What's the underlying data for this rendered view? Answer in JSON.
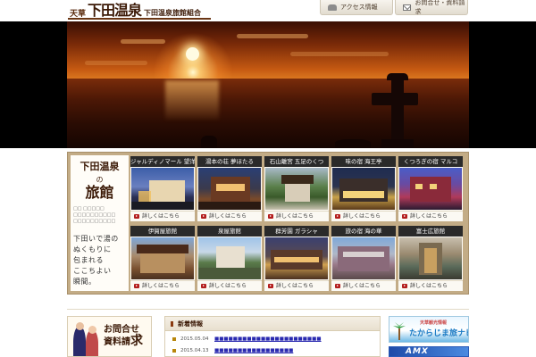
{
  "header": {
    "logo_prefix": "天草",
    "logo_main": "下田温泉",
    "logo_sub": "下田温泉旅館組合",
    "nav_access": "アクセス情報",
    "nav_contact": "お問合せ・資料請求"
  },
  "panel": {
    "title_line1": "下田温泉",
    "title_no": "の",
    "title_line2": "旅館",
    "small_text": "□□ □□□□□\n□□□□□□□□□□\n□□□□□□□□□□",
    "message": "下田いで湯の\nぬくもりに\n包まれる\nここちよい\n瞬間。"
  },
  "ryokan_cards": [
    {
      "name": "ジャルディノマール 望洋閣",
      "link": "詳しくはこちら"
    },
    {
      "name": "湯本の荘 夢ほたる",
      "link": "詳しくはこちら"
    },
    {
      "name": "石山離宮 五足のくつ",
      "link": "詳しくはこちら"
    },
    {
      "name": "味の宿 海王亭",
      "link": "詳しくはこちら"
    },
    {
      "name": "くつろぎの宿 マルコ",
      "link": "詳しくはこちら"
    },
    {
      "name": "伊賀屋旅館",
      "link": "詳しくはこちら"
    },
    {
      "name": "泉屋旅館",
      "link": "詳しくはこちら"
    },
    {
      "name": "群芳園 ガラシャ",
      "link": "詳しくはこちら"
    },
    {
      "name": "旅の宿 海の華",
      "link": "詳しくはこちら"
    },
    {
      "name": "富士広旅館",
      "link": "詳しくはこちら"
    }
  ],
  "contact_box": {
    "line1": "お問合せ",
    "line2": "資料請",
    "line2_big": "求"
  },
  "news": {
    "heading": "新着情報",
    "items": [
      {
        "date": "2015.05.04",
        "title": "■■■■■■■■■■■■■■■■■■■■■■■"
      },
      {
        "date": "2015.04.13",
        "title": "■■■■■■■■■■■■■■■■■"
      }
    ]
  },
  "banners": {
    "b1_small": "天草観光情報",
    "b1_main": "たからじま旅ナビ",
    "b2_text": "AMX"
  },
  "colors": {
    "brand_brown": "#3b1906",
    "panel_tan": "#c3ac86",
    "link_red": "#b31d1d"
  }
}
